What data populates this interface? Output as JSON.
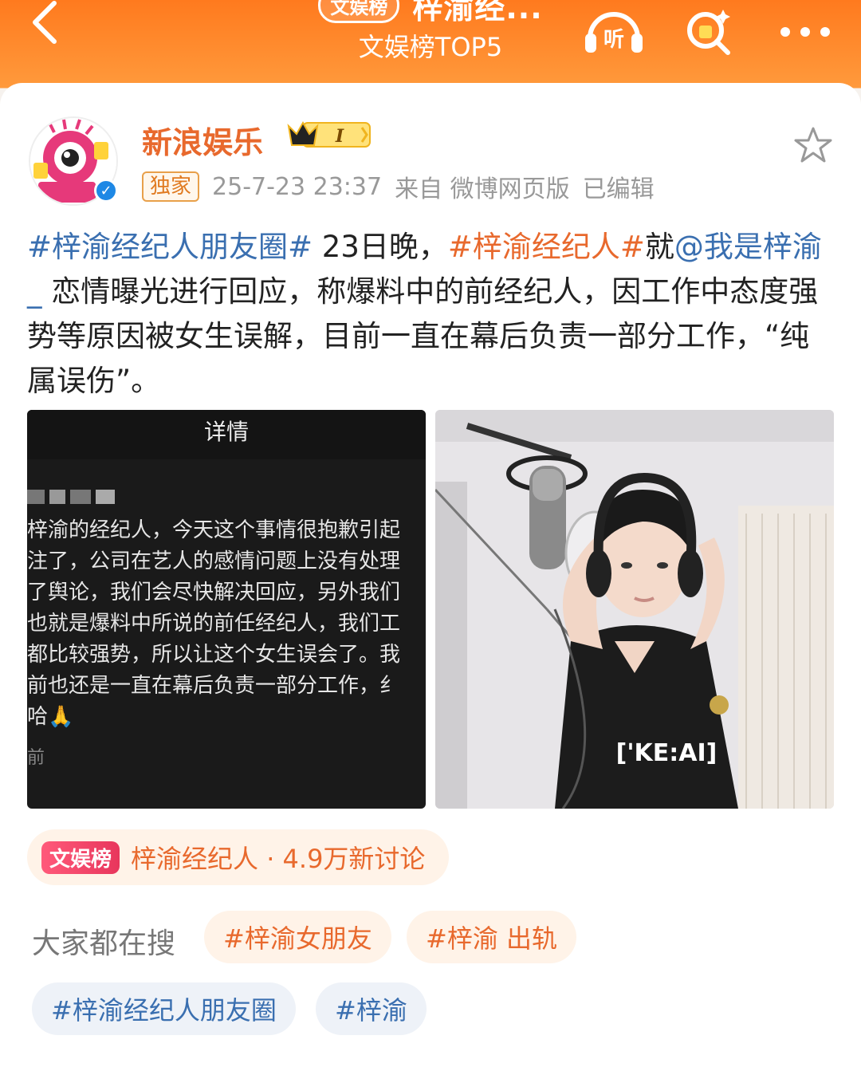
{
  "header": {
    "badge": "文娱榜",
    "title": "梓渝经...",
    "subtitle": "文娱榜TOP5",
    "listen_label": "听"
  },
  "post": {
    "user_name": "新浪娱乐",
    "vip_level": "I",
    "tag": "独家",
    "timestamp": "25-7-23 23:37",
    "source": "来自 微博网页版",
    "edited": "已编辑",
    "content": {
      "hashtag1": "#梓渝经纪人朋友圈#",
      "text1": " 23日晚，",
      "hashtag2": "#梓渝经纪人#",
      "text2": "就",
      "mention": "@我是梓渝_",
      "text3": " 恋情曝光进行回应，称爆料中的前经纪人，因工作中态度强势等原因被女生误解，目前一直在幕后负责一部分工作，“纯属误伤”。"
    }
  },
  "image1": {
    "bar_title": "详情",
    "lines": [
      "梓渝的经纪人，今天这个事情很抱歉引起",
      "注了，公司在艺人的感情问题上没有处理",
      "了舆论，我们会尽快解决回应，另外我们",
      "也就是爆料中所说的前任经纪人，我们工",
      "都比较强势，所以让这个女生误会了。我",
      "前也还是一直在幕后负责一部分工作，纟",
      "哈🙏"
    ],
    "footer": "前"
  },
  "image2": {
    "shirt_text": "['KE:AI]"
  },
  "topic": {
    "badge": "文娱榜",
    "text": "梓渝经纪人 · 4.9万新讨论"
  },
  "search": {
    "label": "大家都在搜",
    "chips": [
      "#梓渝女朋友",
      "#梓渝 出轨",
      "#梓渝经纪人朋友圈",
      "#梓渝"
    ]
  },
  "colors": {
    "header_orange": "#ff7a1e",
    "accent_orange": "#e8692d",
    "link_blue": "#3a6fb0"
  }
}
